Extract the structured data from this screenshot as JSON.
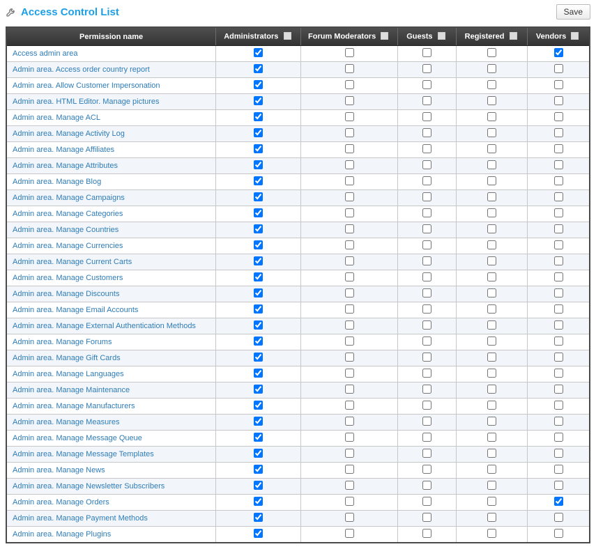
{
  "header": {
    "title": "Access Control List",
    "save_label": "Save"
  },
  "columns": [
    {
      "key": "admin",
      "label": "Administrators"
    },
    {
      "key": "mod",
      "label": "Forum Moderators"
    },
    {
      "key": "guest",
      "label": "Guests"
    },
    {
      "key": "reg",
      "label": "Registered"
    },
    {
      "key": "vendor",
      "label": "Vendors"
    }
  ],
  "name_header": "Permission name",
  "permissions": [
    {
      "name": "Access admin area",
      "admin": true,
      "mod": false,
      "guest": false,
      "reg": false,
      "vendor": true
    },
    {
      "name": "Admin area. Access order country report",
      "admin": true,
      "mod": false,
      "guest": false,
      "reg": false,
      "vendor": false
    },
    {
      "name": "Admin area. Allow Customer Impersonation",
      "admin": true,
      "mod": false,
      "guest": false,
      "reg": false,
      "vendor": false
    },
    {
      "name": "Admin area. HTML Editor. Manage pictures",
      "admin": true,
      "mod": false,
      "guest": false,
      "reg": false,
      "vendor": false
    },
    {
      "name": "Admin area. Manage ACL",
      "admin": true,
      "mod": false,
      "guest": false,
      "reg": false,
      "vendor": false
    },
    {
      "name": "Admin area. Manage Activity Log",
      "admin": true,
      "mod": false,
      "guest": false,
      "reg": false,
      "vendor": false
    },
    {
      "name": "Admin area. Manage Affiliates",
      "admin": true,
      "mod": false,
      "guest": false,
      "reg": false,
      "vendor": false
    },
    {
      "name": "Admin area. Manage Attributes",
      "admin": true,
      "mod": false,
      "guest": false,
      "reg": false,
      "vendor": false
    },
    {
      "name": "Admin area. Manage Blog",
      "admin": true,
      "mod": false,
      "guest": false,
      "reg": false,
      "vendor": false
    },
    {
      "name": "Admin area. Manage Campaigns",
      "admin": true,
      "mod": false,
      "guest": false,
      "reg": false,
      "vendor": false
    },
    {
      "name": "Admin area. Manage Categories",
      "admin": true,
      "mod": false,
      "guest": false,
      "reg": false,
      "vendor": false
    },
    {
      "name": "Admin area. Manage Countries",
      "admin": true,
      "mod": false,
      "guest": false,
      "reg": false,
      "vendor": false
    },
    {
      "name": "Admin area. Manage Currencies",
      "admin": true,
      "mod": false,
      "guest": false,
      "reg": false,
      "vendor": false
    },
    {
      "name": "Admin area. Manage Current Carts",
      "admin": true,
      "mod": false,
      "guest": false,
      "reg": false,
      "vendor": false
    },
    {
      "name": "Admin area. Manage Customers",
      "admin": true,
      "mod": false,
      "guest": false,
      "reg": false,
      "vendor": false
    },
    {
      "name": "Admin area. Manage Discounts",
      "admin": true,
      "mod": false,
      "guest": false,
      "reg": false,
      "vendor": false
    },
    {
      "name": "Admin area. Manage Email Accounts",
      "admin": true,
      "mod": false,
      "guest": false,
      "reg": false,
      "vendor": false
    },
    {
      "name": "Admin area. Manage External Authentication Methods",
      "admin": true,
      "mod": false,
      "guest": false,
      "reg": false,
      "vendor": false
    },
    {
      "name": "Admin area. Manage Forums",
      "admin": true,
      "mod": false,
      "guest": false,
      "reg": false,
      "vendor": false
    },
    {
      "name": "Admin area. Manage Gift Cards",
      "admin": true,
      "mod": false,
      "guest": false,
      "reg": false,
      "vendor": false
    },
    {
      "name": "Admin area. Manage Languages",
      "admin": true,
      "mod": false,
      "guest": false,
      "reg": false,
      "vendor": false
    },
    {
      "name": "Admin area. Manage Maintenance",
      "admin": true,
      "mod": false,
      "guest": false,
      "reg": false,
      "vendor": false
    },
    {
      "name": "Admin area. Manage Manufacturers",
      "admin": true,
      "mod": false,
      "guest": false,
      "reg": false,
      "vendor": false
    },
    {
      "name": "Admin area. Manage Measures",
      "admin": true,
      "mod": false,
      "guest": false,
      "reg": false,
      "vendor": false
    },
    {
      "name": "Admin area. Manage Message Queue",
      "admin": true,
      "mod": false,
      "guest": false,
      "reg": false,
      "vendor": false
    },
    {
      "name": "Admin area. Manage Message Templates",
      "admin": true,
      "mod": false,
      "guest": false,
      "reg": false,
      "vendor": false
    },
    {
      "name": "Admin area. Manage News",
      "admin": true,
      "mod": false,
      "guest": false,
      "reg": false,
      "vendor": false
    },
    {
      "name": "Admin area. Manage Newsletter Subscribers",
      "admin": true,
      "mod": false,
      "guest": false,
      "reg": false,
      "vendor": false
    },
    {
      "name": "Admin area. Manage Orders",
      "admin": true,
      "mod": false,
      "guest": false,
      "reg": false,
      "vendor": true
    },
    {
      "name": "Admin area. Manage Payment Methods",
      "admin": true,
      "mod": false,
      "guest": false,
      "reg": false,
      "vendor": false
    },
    {
      "name": "Admin area. Manage Plugins",
      "admin": true,
      "mod": false,
      "guest": false,
      "reg": false,
      "vendor": false
    }
  ]
}
